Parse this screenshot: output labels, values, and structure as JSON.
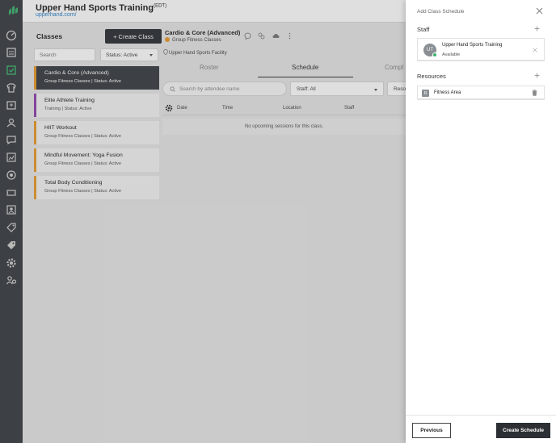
{
  "brand": {
    "title": "Upper Hand Sports Training",
    "timezone": "(EDT)",
    "url": "upperhand.com/"
  },
  "nav": {
    "logo": "upper-hand-logo",
    "items": [
      {
        "name": "dashboard-icon",
        "active": false
      },
      {
        "name": "calendar-icon",
        "active": false
      },
      {
        "name": "classes-icon",
        "active": true
      },
      {
        "name": "teams-icon",
        "active": false
      },
      {
        "name": "events-icon",
        "active": false
      },
      {
        "name": "clients-icon",
        "active": false
      },
      {
        "name": "messages-icon",
        "active": false
      },
      {
        "name": "reports-icon",
        "active": false
      },
      {
        "name": "marketing-icon",
        "active": false
      },
      {
        "name": "tickets-icon",
        "active": false
      },
      {
        "name": "contacts-icon",
        "active": false
      },
      {
        "name": "discount-tag-icon",
        "active": false
      },
      {
        "name": "pricing-tag-icon",
        "active": false
      },
      {
        "name": "settings-icon",
        "active": false
      },
      {
        "name": "staff-settings-icon",
        "active": false
      }
    ]
  },
  "classes": {
    "title": "Classes",
    "create_label": "+ Create Class",
    "search_placeholder": "Search",
    "status_filter": "Status: Active",
    "items": [
      {
        "name": "Cardio & Core (Advanced)",
        "meta": "Group Fitness Classes | Status: Active",
        "color": "#e89a2d",
        "active": true
      },
      {
        "name": "Elite Athlete Training",
        "meta": "Training | Status: Active",
        "color": "#8e44ad",
        "active": false
      },
      {
        "name": "HIIT Workout",
        "meta": "Group Fitness Classes | Status: Active",
        "color": "#e89a2d",
        "active": false
      },
      {
        "name": "Mindful Movement: Yoga Fusion",
        "meta": "Group Fitness Classes | Status: Active",
        "color": "#e89a2d",
        "active": false
      },
      {
        "name": "Total Body Conditioning",
        "meta": "Group Fitness Classes | Status: Active",
        "color": "#e89a2d",
        "active": false
      }
    ]
  },
  "main": {
    "title": "Cardio & Core (Advanced)",
    "category": "Group Fitness Classes",
    "category_color": "#e89a2d",
    "facility": "Upper Hand Sports Facility",
    "tabs": [
      "Roster",
      "Schedule",
      "Compl"
    ],
    "active_tab": "Schedule",
    "search_placeholder": "Search by attendee name",
    "staff_filter": "Staff: All",
    "resource_filter": "Resou",
    "columns": [
      "Date",
      "Time",
      "Location",
      "Staff"
    ],
    "empty_message": "No upcoming sessions for this class."
  },
  "drawer": {
    "title": "Add Class Schedule",
    "staff_label": "Staff",
    "staff": {
      "initials": "UT",
      "name": "Upper Hand Sports Training",
      "status": "Available"
    },
    "resources_label": "Resources",
    "resource": {
      "icon_letter": "R",
      "name": "Fitness Area"
    },
    "previous_label": "Previous",
    "create_label": "Create Schedule"
  }
}
